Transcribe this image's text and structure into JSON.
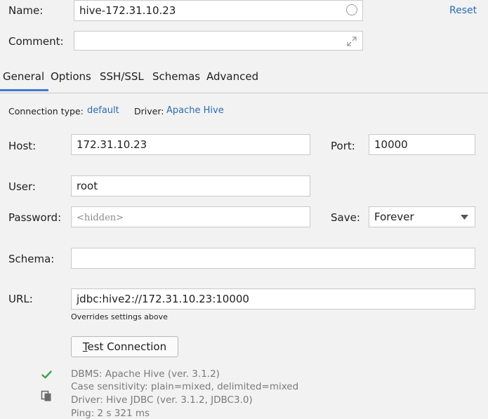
{
  "header": {
    "name_label": "Name:",
    "name_value": "hive-172.31.10.23",
    "reset_label": "Reset",
    "comment_label": "Comment:",
    "comment_value": ""
  },
  "tabs": [
    {
      "label": "General",
      "active": true
    },
    {
      "label": "Options",
      "active": false
    },
    {
      "label": "SSH/SSL",
      "active": false
    },
    {
      "label": "Schemas",
      "active": false
    },
    {
      "label": "Advanced",
      "active": false
    }
  ],
  "connection": {
    "type_label": "Connection type:",
    "type_value": "default",
    "driver_label": "Driver:",
    "driver_value": "Apache Hive"
  },
  "form": {
    "host_label": "Host:",
    "host_value": "172.31.10.23",
    "port_label": "Port:",
    "port_value": "10000",
    "user_label": "User:",
    "user_value": "root",
    "password_label": "Password:",
    "password_placeholder": "<hidden>",
    "save_label": "Save:",
    "save_value": "Forever",
    "schema_label": "Schema:",
    "schema_value": "",
    "url_label": "URL:",
    "url_value": "jdbc:hive2://172.31.10.23:10000",
    "url_note": "Overrides settings above"
  },
  "test": {
    "button_mnemonic": "T",
    "button_rest": "est Connection",
    "dbms": "DBMS: Apache Hive (ver. 3.1.2)",
    "case_sensitivity": "Case sensitivity: plain=mixed, delimited=mixed",
    "driver": "Driver: Hive JDBC (ver. 3.1.2, JDBC3.0)",
    "ping": "Ping: 2 s 321 ms"
  },
  "colors": {
    "link": "#2a6db0",
    "tab_underline": "#3d7bd0",
    "success": "#3fa14a"
  },
  "icons": {
    "status": "check-icon",
    "copy": "copy-icon",
    "expand": "expand-icon",
    "name_circle": "circle-icon",
    "dropdown": "chevron-down-icon"
  }
}
